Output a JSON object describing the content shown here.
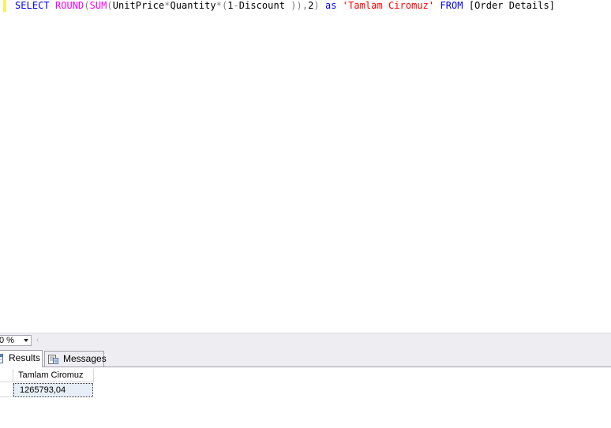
{
  "editor": {
    "tokens": [
      {
        "text": "SELECT",
        "kind": "kw"
      },
      {
        "text": " ",
        "kind": "plain"
      },
      {
        "text": "ROUND",
        "kind": "fn"
      },
      {
        "text": "(",
        "kind": "op"
      },
      {
        "text": "SUM",
        "kind": "fn"
      },
      {
        "text": "(",
        "kind": "op"
      },
      {
        "text": "UnitPrice",
        "kind": "plain"
      },
      {
        "text": "*",
        "kind": "op"
      },
      {
        "text": "Quantity",
        "kind": "plain"
      },
      {
        "text": "*(",
        "kind": "op"
      },
      {
        "text": "1",
        "kind": "plain"
      },
      {
        "text": "-",
        "kind": "op"
      },
      {
        "text": "Discount ",
        "kind": "plain"
      },
      {
        "text": ")),",
        "kind": "op"
      },
      {
        "text": "2",
        "kind": "plain"
      },
      {
        "text": ")",
        "kind": "op"
      },
      {
        "text": " ",
        "kind": "plain"
      },
      {
        "text": "as",
        "kind": "kw"
      },
      {
        "text": " ",
        "kind": "plain"
      },
      {
        "text": "'Tamlam Ciromuz'",
        "kind": "str"
      },
      {
        "text": " ",
        "kind": "plain"
      },
      {
        "text": "FROM",
        "kind": "kw"
      },
      {
        "text": " ",
        "kind": "plain"
      },
      {
        "text": "[Order Details]",
        "kind": "plain"
      }
    ],
    "colors": {
      "keyword": "#0000ff",
      "function": "#ff00ff",
      "operator": "#808080",
      "string": "#ff0000",
      "change_marker": "#ffee62"
    }
  },
  "status": {
    "zoom_value": "0 %",
    "zoom_dropdown_icon": "chevron-down-icon",
    "scroll_left_icon": "chevron-left-icon"
  },
  "tabs": [
    {
      "label": "Results",
      "icon": "results-grid-icon",
      "active": true
    },
    {
      "label": "Messages",
      "icon": "messages-icon",
      "active": false
    }
  ],
  "grid": {
    "columns": [
      "Tamlam Ciromuz"
    ],
    "rows": [
      [
        "1265793,04"
      ]
    ]
  }
}
